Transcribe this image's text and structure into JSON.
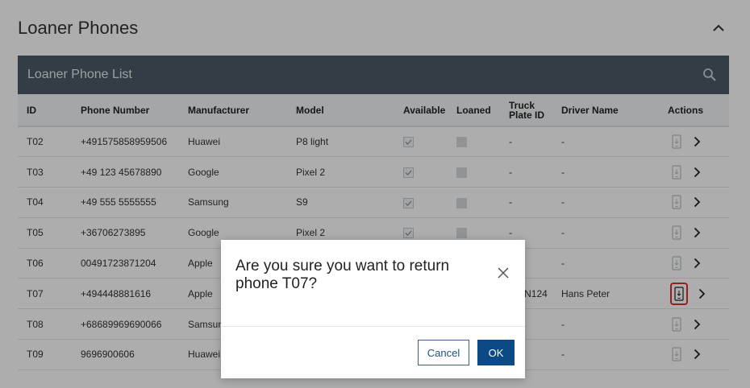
{
  "section": {
    "title": "Loaner Phones"
  },
  "card": {
    "title": "Loaner Phone List"
  },
  "table": {
    "headers": [
      "ID",
      "Phone Number",
      "Manufacturer",
      "Model",
      "Available",
      "Loaned",
      "Truck Plate ID",
      "Driver Name",
      "Actions"
    ],
    "rows": [
      {
        "id": "T02",
        "phone": "+491575858959506",
        "manufacturer": "Huawei",
        "model": "P8 light",
        "available": true,
        "loaned": false,
        "truck": "-",
        "driver": "-"
      },
      {
        "id": "T03",
        "phone": "+49 123 45678890",
        "manufacturer": "Google",
        "model": "Pixel 2",
        "available": true,
        "loaned": false,
        "truck": "-",
        "driver": "-"
      },
      {
        "id": "T04",
        "phone": "+49 555 5555555",
        "manufacturer": "Samsung",
        "model": "S9",
        "available": true,
        "loaned": false,
        "truck": "-",
        "driver": "-"
      },
      {
        "id": "T05",
        "phone": "+36706273895",
        "manufacturer": "Google",
        "model": "Pixel 2",
        "available": true,
        "loaned": false,
        "truck": "-",
        "driver": "-"
      },
      {
        "id": "T06",
        "phone": "00491723871204",
        "manufacturer": "Apple",
        "model": "",
        "available": true,
        "loaned": false,
        "truck": "-",
        "driver": "-"
      },
      {
        "id": "T07",
        "phone": "+494448881616",
        "manufacturer": "Apple",
        "model": "",
        "available": false,
        "loaned": true,
        "truck": "RTIN124",
        "driver": "Hans Peter"
      },
      {
        "id": "T08",
        "phone": "+68689969690066",
        "manufacturer": "Samsung",
        "model": "",
        "available": true,
        "loaned": false,
        "truck": "-",
        "driver": "-"
      },
      {
        "id": "T09",
        "phone": "9696900606",
        "manufacturer": "Huawei",
        "model": "",
        "available": true,
        "loaned": false,
        "truck": "-",
        "driver": "-"
      }
    ]
  },
  "dialog": {
    "message": "Are you sure you want to return phone T07?",
    "cancel_label": "Cancel",
    "ok_label": "OK"
  },
  "icons": {
    "collapse": "chevron-up-icon",
    "search": "search-icon",
    "return_phone": "phone-return-icon",
    "details": "chevron-right-icon",
    "close": "close-icon"
  },
  "colors": {
    "header_bar": "#4d5b66",
    "highlight": "#e12d2d",
    "primary": "#0b4a85"
  }
}
